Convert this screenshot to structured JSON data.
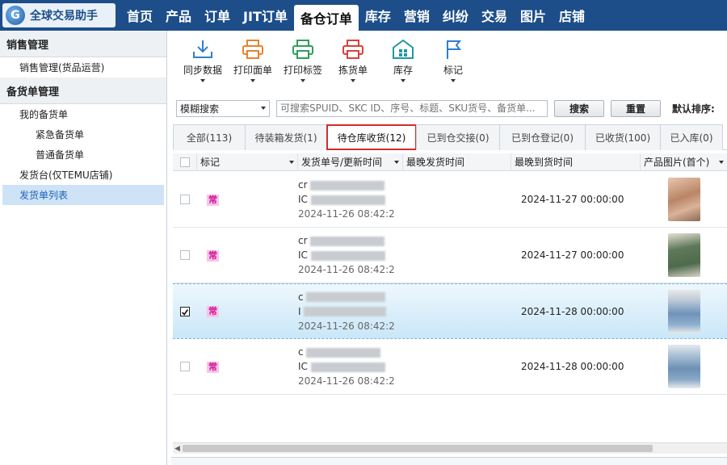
{
  "app": {
    "logo_text": "全球交易助手",
    "logo_glyph": "G"
  },
  "nav": [
    {
      "label": "首页"
    },
    {
      "label": "产品"
    },
    {
      "label": "订单"
    },
    {
      "label": "JIT订单"
    },
    {
      "label": "备仓订单",
      "active": true
    },
    {
      "label": "库存"
    },
    {
      "label": "营销"
    },
    {
      "label": "纠纷"
    },
    {
      "label": "交易"
    },
    {
      "label": "图片"
    },
    {
      "label": "店铺"
    }
  ],
  "sidebar": {
    "section1": "销售管理",
    "item_sales_ops": "销售管理(货品运营)",
    "section2": "备货单管理",
    "item_my_orders": "我的备货单",
    "item_urgent": "紧急备货单",
    "item_normal": "普通备货单",
    "item_ship_desk": "发货台(仅TEMU店铺)",
    "item_ship_list": "发货单列表"
  },
  "toolbar": {
    "sync": "同步数据",
    "print_face": "打印面单",
    "print_label": "打印标签",
    "pick_list": "拣货单",
    "inventory": "库存",
    "mark": "标记"
  },
  "search": {
    "mode": "模糊搜索",
    "placeholder": "可搜索SPUID、SKC ID、序号、标题、SKU货号、备货单...",
    "search_btn": "搜索",
    "reset_btn": "重置",
    "sort_label": "默认排序:"
  },
  "tabs": [
    {
      "label": "全部(113)"
    },
    {
      "label": "待装箱发货(1)"
    },
    {
      "label": "待仓库收货(12)",
      "active": true
    },
    {
      "label": "已到仓交接(0)"
    },
    {
      "label": "已到仓登记(0)"
    },
    {
      "label": "已收货(100)"
    },
    {
      "label": "已入库(0)"
    }
  ],
  "table": {
    "headers": {
      "mark": "标记",
      "order_no": "发货单号/更新时间",
      "ship_time": "最晚发货时间",
      "arrive_time": "最晚到货时间",
      "image": "产品图片(首个)"
    },
    "rows": [
      {
        "badge": "常",
        "line1": "cr",
        "line2": "IC",
        "updated": "2024-11-26 08:42:2",
        "arrive": "2024-11-27 00:00:00",
        "checked": false,
        "selected": false,
        "thumb": "knit-set-photo"
      },
      {
        "badge": "常",
        "line1": "cr",
        "line2": "IC",
        "updated": "2024-11-26 08:42:2",
        "arrive": "2024-11-27 00:00:00",
        "checked": false,
        "selected": false,
        "thumb": "green-set-photo"
      },
      {
        "badge": "常",
        "line1": "c",
        "line2": "I",
        "updated": "2024-11-26 08:42:2",
        "arrive": "2024-11-28 00:00:00",
        "checked": true,
        "selected": true,
        "thumb": "jeans-photo"
      },
      {
        "badge": "常",
        "line1": "c",
        "line2": "IC",
        "updated": "2024-11-26 08:42:2",
        "arrive": "2024-11-28 00:00:00",
        "checked": false,
        "selected": false,
        "thumb": "jeans-photo"
      }
    ]
  },
  "colors": {
    "nav_bg": "#1d4e8a",
    "accent": "#1a63b8",
    "active_tab_border": "#d32b2b",
    "badge_bg": "#f7c5ea",
    "badge_fg": "#d0189a"
  }
}
